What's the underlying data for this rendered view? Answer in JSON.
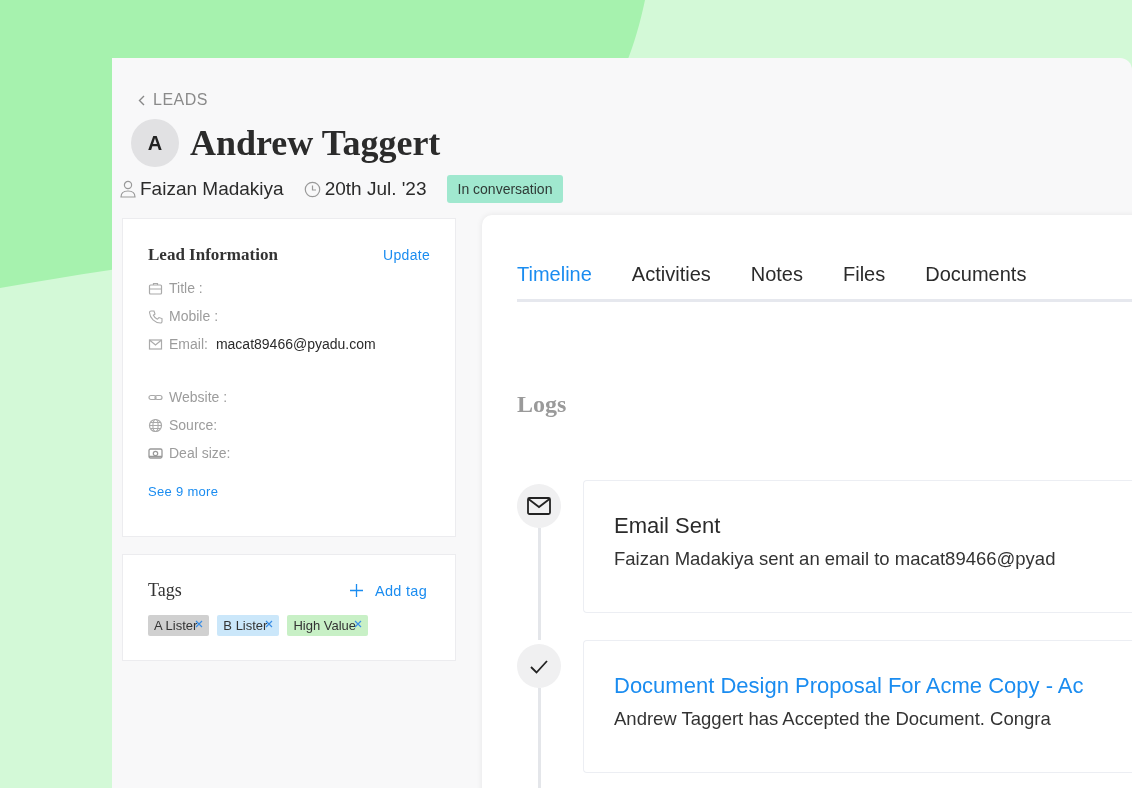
{
  "breadcrumb": {
    "label": "LEADS"
  },
  "lead": {
    "initial": "A",
    "name": "Andrew Taggert",
    "owner": "Faizan Madakiya",
    "date": "20th Jul. '23",
    "status": "In conversation"
  },
  "lead_information": {
    "title": "Lead Information",
    "action": "Update",
    "field_groups": [
      {
        "fields": [
          {
            "kind": "title",
            "label": "Title :"
          },
          {
            "kind": "mobile",
            "label": "Mobile :"
          },
          {
            "kind": "email",
            "label": "Email:",
            "value": "macat89466@pyadu.com"
          }
        ]
      },
      {
        "fields": [
          {
            "kind": "website",
            "label": "Website :"
          },
          {
            "kind": "source",
            "label": "Source:"
          },
          {
            "kind": "deal_size",
            "label": "Deal size:"
          }
        ]
      }
    ],
    "more_link": "See 9 more"
  },
  "tags": {
    "title": "Tags",
    "action": "Add tag",
    "items": [
      {
        "label": "A Lister",
        "color": "#d0d0d0"
      },
      {
        "label": "B Lister",
        "color": "#cbe7fa"
      },
      {
        "label": "High Value",
        "color": "#c8f0c6"
      }
    ]
  },
  "tabs": [
    {
      "label": "Timeline",
      "selected": true
    },
    {
      "label": "Activities",
      "selected": false
    },
    {
      "label": "Notes",
      "selected": false
    },
    {
      "label": "Files",
      "selected": false
    },
    {
      "label": "Documents",
      "selected": false
    }
  ],
  "logs": {
    "title": "Logs",
    "entries": [
      {
        "kind": "email",
        "title": "Email Sent",
        "link": false,
        "text": "Faizan Madakiya sent an email to macat89466@pyad"
      },
      {
        "kind": "accepted",
        "title": "Document Design Proposal For Acme Copy - Ac",
        "link": true,
        "text": "Andrew Taggert has Accepted the Document. Congra"
      }
    ]
  }
}
